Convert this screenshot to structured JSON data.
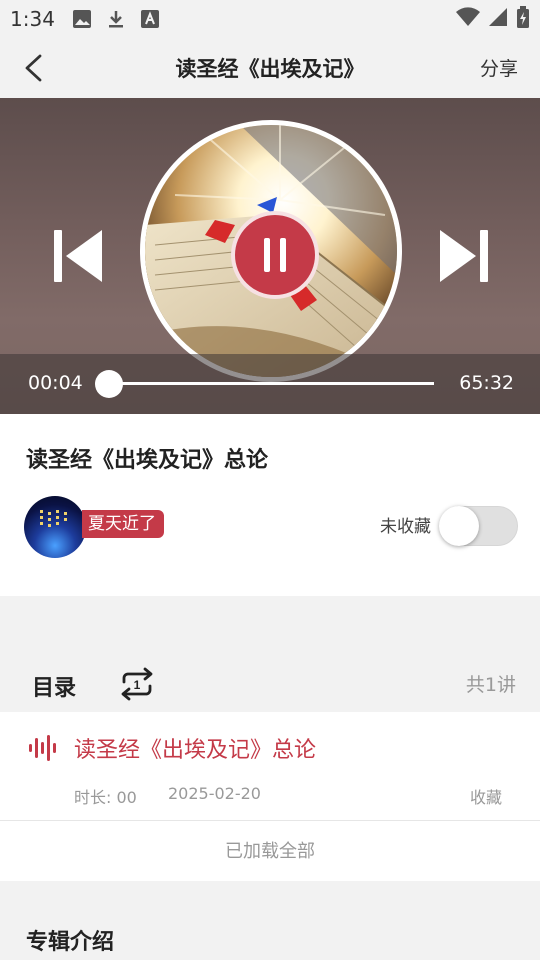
{
  "status_bar": {
    "time": "1:34",
    "icons": [
      "image-icon",
      "download-icon",
      "font-icon"
    ],
    "right_icons": [
      "wifi-icon",
      "signal-icon",
      "battery-icon"
    ]
  },
  "header": {
    "title": "读圣经《出埃及记》",
    "share_label": "分享",
    "back_icon": "back-arrow-icon"
  },
  "player": {
    "current_time": "00:04",
    "total_time": "65:32",
    "progress_fraction": 0.001,
    "state": "playing",
    "prev_icon": "skip-previous-icon",
    "next_icon": "skip-next-icon",
    "pause_icon": "pause-icon"
  },
  "episode": {
    "title": "读圣经《出埃及记》总论",
    "author_tag": "夏天近了",
    "favorite_label": "未收藏",
    "favorite_on": false
  },
  "toc": {
    "label": "目录",
    "loop_icon": "repeat-one-icon",
    "count_label": "共1讲",
    "items": [
      {
        "title": "读圣经《出埃及记》总论",
        "duration": "时长: 00",
        "date": "2025-02-20",
        "favorite": "收藏"
      }
    ],
    "loaded_all": "已加载全部"
  },
  "album": {
    "intro_label": "专辑介绍"
  },
  "colors": {
    "accent": "#c43a48",
    "background": "#f2f2f2",
    "card": "#ffffff"
  }
}
